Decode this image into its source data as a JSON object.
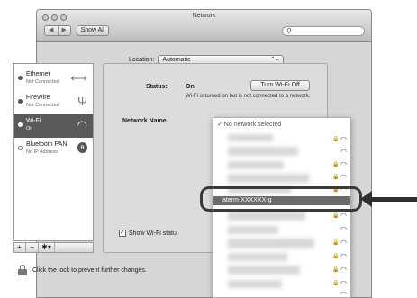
{
  "window": {
    "title": "Network"
  },
  "toolbar": {
    "back_glyph": "◀",
    "forward_glyph": "▶",
    "show_all_label": "Show All",
    "search_icon": "search-icon"
  },
  "location": {
    "label": "Location:",
    "value": "Automatic",
    "arrows": "⌃⌄"
  },
  "services": [
    {
      "name": "Ethernet",
      "status": "Not Connected",
      "icon": "ethernet-icon",
      "glyph": "⟷"
    },
    {
      "name": "FireWire",
      "status": "Not Connected",
      "icon": "firewire-icon",
      "glyph": "Ψ"
    },
    {
      "name": "Wi-Fi",
      "status": "On",
      "icon": "wifi-icon",
      "glyph": "◠"
    },
    {
      "name": "Bluetooth PAN",
      "status": "No IP Address",
      "icon": "bluetooth-icon",
      "glyph": "ʙ"
    }
  ],
  "sidebar_controls": {
    "add": "+",
    "remove": "−",
    "action": "✱▾"
  },
  "panel": {
    "status_label": "Status:",
    "status_value": "On",
    "turn_off_button": "Turn Wi-Fi Off",
    "status_description": "Wi-Fi is turned on but is not connected to a network.",
    "network_name_label": "Network Name",
    "show_wifi_label": "Show Wi-Fi statu",
    "checkbox_mark": "✓"
  },
  "network_menu": {
    "first_item": "✓ No network selected",
    "selected_item": "aterm-XXXXXX-g"
  },
  "lock": {
    "text": "Click the lock to prevent further changes."
  },
  "colors": {
    "highlight": "#6a6a6a",
    "callout": "#3a3a3a"
  }
}
